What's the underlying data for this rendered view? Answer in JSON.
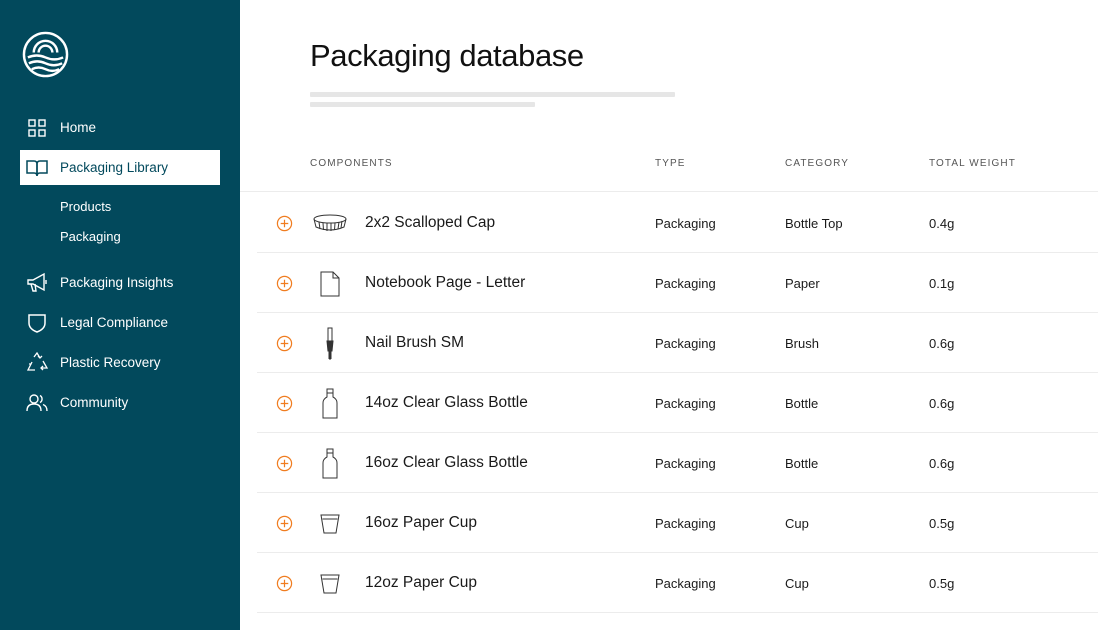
{
  "app": {
    "title": "Packaging database"
  },
  "colors": {
    "sidebar": "#02495c",
    "accent": "#f07c1f"
  },
  "sidebar": {
    "nav": [
      {
        "label": "Home",
        "icon": "grid-icon"
      },
      {
        "label": "Packaging Library",
        "icon": "book-icon",
        "active": true
      },
      {
        "label": "Packaging Insights",
        "icon": "megaphone-icon"
      },
      {
        "label": "Legal Compliance",
        "icon": "shield-icon"
      },
      {
        "label": "Plastic Recovery",
        "icon": "recycle-icon"
      },
      {
        "label": "Community",
        "icon": "users-icon"
      }
    ],
    "sub": [
      {
        "label": "Products"
      },
      {
        "label": "Packaging"
      }
    ]
  },
  "table": {
    "headers": {
      "components": "COMPONENTS",
      "type": "TYPE",
      "category": "CATEGORY",
      "weight": "TOTAL WEIGHT"
    },
    "rows": [
      {
        "name": "2x2 Scalloped Cap",
        "type": "Packaging",
        "category": "Bottle Top",
        "weight": "0.4g",
        "icon": "cap-icon"
      },
      {
        "name": "Notebook Page - Letter",
        "type": "Packaging",
        "category": "Paper",
        "weight": "0.1g",
        "icon": "page-icon"
      },
      {
        "name": "Nail Brush SM",
        "type": "Packaging",
        "category": "Brush",
        "weight": "0.6g",
        "icon": "brush-icon"
      },
      {
        "name": "14oz Clear Glass Bottle",
        "type": "Packaging",
        "category": "Bottle",
        "weight": "0.6g",
        "icon": "bottle-icon"
      },
      {
        "name": "16oz Clear Glass Bottle",
        "type": "Packaging",
        "category": "Bottle",
        "weight": "0.6g",
        "icon": "bottle-icon"
      },
      {
        "name": "16oz Paper Cup",
        "type": "Packaging",
        "category": "Cup",
        "weight": "0.5g",
        "icon": "cup-icon"
      },
      {
        "name": "12oz Paper Cup",
        "type": "Packaging",
        "category": "Cup",
        "weight": "0.5g",
        "icon": "cup-icon"
      }
    ]
  }
}
